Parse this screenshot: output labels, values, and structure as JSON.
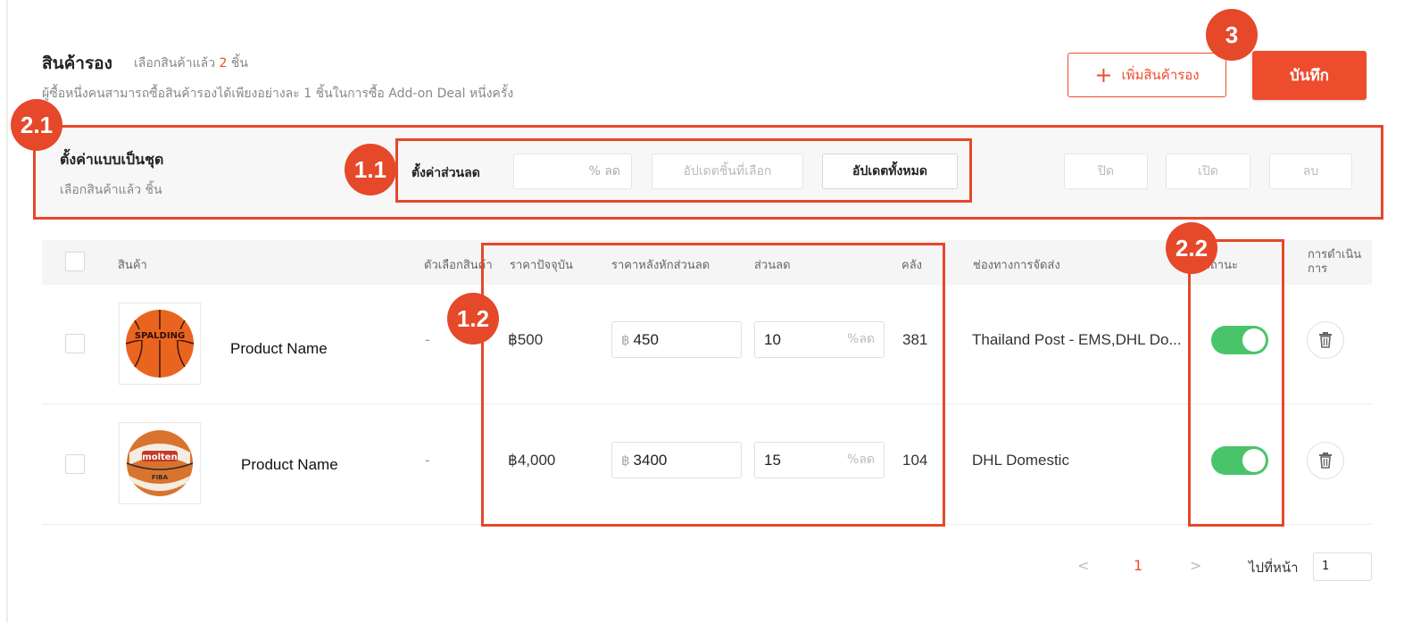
{
  "header": {
    "title": "สินค้ารอง",
    "selected_prefix": "เลือกสินค้าแล้ว",
    "selected_count": "2",
    "selected_suffix": "ชิ้น",
    "subtitle": "ผู้ซื้อหนึ่งคนสามารถซื้อสินค้ารองได้เพียงอย่างละ 1 ชิ้นในการซื้อ Add-on Deal หนึ่งครั้ง",
    "add_button": "เพิ่มสินค้ารอง",
    "save_button": "บันทึก"
  },
  "batch": {
    "title": "ตั้งค่าแบบเป็นชุด",
    "subtitle": "เลือกสินค้าแล้ว ชิ้น",
    "discount_label": "ตั้งค่าส่วนลด",
    "discount_placeholder": "% ลด",
    "update_selected": "อัปเดตชิ้นที่เลือก",
    "update_all": "อัปเดตทั้งหมด",
    "disable": "ปิด",
    "enable": "เปิด",
    "delete": "ลบ"
  },
  "table": {
    "columns": {
      "product": "สินค้า",
      "variation": "ตัวเลือกสินค้า",
      "current_price": "ราคาปัจจุบัน",
      "discounted_price": "ราคาหลังหักส่วนลด",
      "discount": "ส่วนลด",
      "stock": "คลัง",
      "shipping": "ช่องทางการจัดส่ง",
      "status": "สถานะ",
      "action_line1": "การดำเนิน",
      "action_line2": "การ"
    },
    "rows": [
      {
        "name": "Product Name",
        "variation": "-",
        "current_price": "฿500",
        "currency": "฿",
        "discounted_price": "450",
        "discount": "10",
        "discount_suffix": "%ลด",
        "stock": "381",
        "shipping": "Thailand Post - EMS,DHL Do...",
        "status_on": true,
        "image": "basketball-spalding"
      },
      {
        "name": "Product Name",
        "variation": "-",
        "current_price": "฿4,000",
        "currency": "฿",
        "discounted_price": "3400",
        "discount": "15",
        "discount_suffix": "%ลด",
        "stock": "104",
        "shipping": "DHL Domestic",
        "status_on": true,
        "image": "basketball-molten"
      }
    ]
  },
  "pagination": {
    "prev": "<",
    "current": "1",
    "next": ">",
    "goto_label": "ไปที่หน้า",
    "goto_value": "1"
  },
  "annotations": {
    "b1": "3",
    "b2": "2.1",
    "b3": "1.1",
    "b4": "1.2",
    "b5": "2.2"
  },
  "colors": {
    "accent": "#ee4d2d",
    "highlight": "#e6482a",
    "toggle_on": "#49c46a"
  }
}
